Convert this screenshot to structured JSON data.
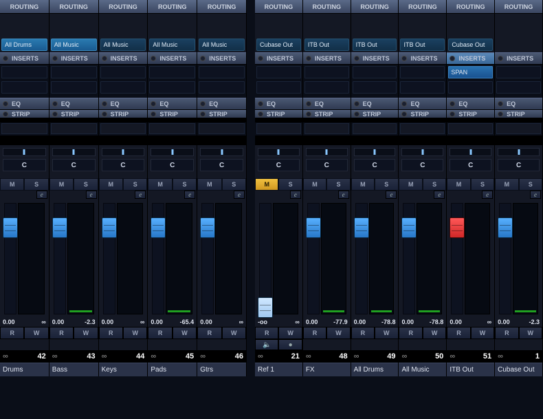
{
  "sections": {
    "routing": "ROUTING",
    "inserts": "INSERTS",
    "eq": "EQ",
    "strip": "STRIP"
  },
  "buttons": {
    "mute": "M",
    "solo": "S",
    "edit": "e",
    "read": "R",
    "write": "W"
  },
  "leftChannels": [
    {
      "route": "All Drums",
      "routeDim": false,
      "pan": "C",
      "db": "0.00",
      "peak": "∞",
      "num": "42",
      "name": "Drums",
      "faderPos": 20,
      "mute": false
    },
    {
      "route": "All Music",
      "routeDim": false,
      "pan": "C",
      "db": "0.00",
      "peak": "-2.3",
      "num": "43",
      "name": "Bass",
      "faderPos": 20,
      "mute": false
    },
    {
      "route": "All Music",
      "routeDim": true,
      "pan": "C",
      "db": "0.00",
      "peak": "∞",
      "num": "44",
      "name": "Keys",
      "faderPos": 20,
      "mute": false
    },
    {
      "route": "All Music",
      "routeDim": true,
      "pan": "C",
      "db": "0.00",
      "peak": "-65.4",
      "num": "45",
      "name": "Pads",
      "faderPos": 20,
      "mute": false
    },
    {
      "route": "All Music",
      "routeDim": true,
      "pan": "C",
      "db": "0.00",
      "peak": "∞",
      "num": "46",
      "name": "Gtrs",
      "faderPos": 20,
      "mute": false
    }
  ],
  "rightChannels": [
    {
      "route": "Cubase Out",
      "routeDim": true,
      "pan": "C",
      "db": "-oo",
      "peak": "∞",
      "num": "21",
      "name": "Ref 1",
      "faderPos": 136,
      "faderLight": true,
      "mute": true,
      "hasExtra": true
    },
    {
      "route": "ITB Out",
      "routeDim": true,
      "pan": "C",
      "db": "0.00",
      "peak": "-77.9",
      "num": "48",
      "name": "FX",
      "faderPos": 20,
      "mute": false
    },
    {
      "route": "ITB Out",
      "routeDim": true,
      "pan": "C",
      "db": "0.00",
      "peak": "-78.8",
      "num": "49",
      "name": "All Drums",
      "faderPos": 20,
      "mute": false
    },
    {
      "route": "ITB Out",
      "routeDim": true,
      "pan": "C",
      "db": "0.00",
      "peak": "-78.8",
      "num": "50",
      "name": "All Music",
      "faderPos": 20,
      "mute": false
    },
    {
      "route": "Cubase Out",
      "routeDim": true,
      "insert": "SPAN",
      "insertsActive": true,
      "pan": "C",
      "db": "0.00",
      "peak": "∞",
      "num": "51",
      "name": "ITB Out",
      "faderPos": 20,
      "faderRed": true,
      "mute": false
    },
    {
      "route": "",
      "pan": "C",
      "db": "0.00",
      "peak": "-2.3",
      "num": "1",
      "name": "Cubase Out",
      "faderPos": 20,
      "mute": false
    }
  ]
}
